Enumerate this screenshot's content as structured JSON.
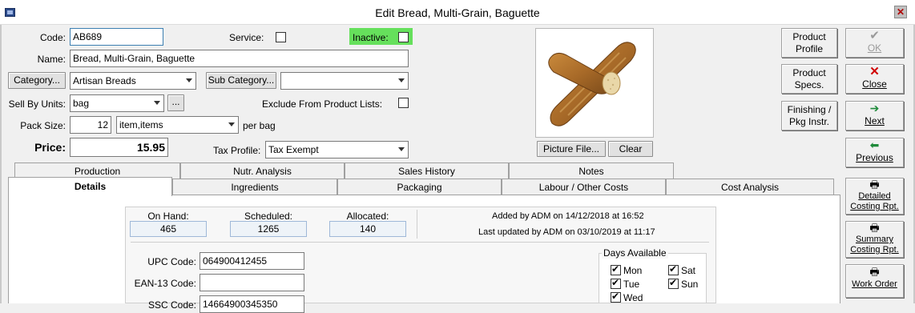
{
  "window": {
    "title": "Edit Bread, Multi-Grain, Baguette",
    "close_glyph": "✕"
  },
  "form": {
    "code_label": "Code:",
    "code_value": "AB689",
    "service_label": "Service:",
    "inactive_label": "Inactive:",
    "name_label": "Name:",
    "name_value": "Bread, Multi-Grain, Baguette",
    "category_button": "Category...",
    "category_value": "Artisan Breads",
    "subcategory_button": "Sub Category...",
    "subcategory_value": "",
    "sell_by_units_label": "Sell By Units:",
    "sell_by_units_value": "bag",
    "ellipsis_button": "...",
    "exclude_label": "Exclude From Product Lists:",
    "pack_size_label": "Pack Size:",
    "pack_size_value": "12",
    "pack_unit_value": "item,items",
    "per_unit_text": "per bag",
    "price_label": "Price:",
    "price_value": "15.95",
    "tax_profile_label": "Tax Profile:",
    "tax_profile_value": "Tax Exempt",
    "inactive_color": "#66e05c"
  },
  "picture": {
    "picture_button": "Picture File...",
    "clear_button": "Clear"
  },
  "right_buttons": {
    "product_profile": "Product Profile",
    "product_specs": "Product Specs.",
    "finishing": "Finishing / Pkg Instr.",
    "ok": "OK",
    "close": "Close",
    "next": "Next",
    "previous": "Previous",
    "detailed_costing": "Detailed Costing Rpt.",
    "summary_costing": "Summary Costing Rpt.",
    "work_order": "Work Order"
  },
  "tabs": {
    "row1": [
      "Production",
      "Nutr. Analysis",
      "Sales History",
      "Notes"
    ],
    "row2": [
      "Details",
      "Ingredients",
      "Packaging",
      "Labour / Other Costs",
      "Cost Analysis"
    ]
  },
  "details": {
    "on_hand_label": "On Hand:",
    "on_hand_value": "465",
    "scheduled_label": "Scheduled:",
    "scheduled_value": "1265",
    "allocated_label": "Allocated:",
    "allocated_value": "140",
    "added_text": "Added by ADM on 14/12/2018 at 16:52",
    "updated_text": "Last updated by ADM on 03/10/2019 at 11:17",
    "upc_label": "UPC Code:",
    "upc_value": "064900412455",
    "ean_label": "EAN-13 Code:",
    "ean_value": "",
    "ssc_label": "SSC Code:",
    "ssc_value": "14664900345350",
    "days_title": "Days Available",
    "days": [
      "Mon",
      "Sat",
      "Tue",
      "Sun",
      "Wed"
    ]
  }
}
